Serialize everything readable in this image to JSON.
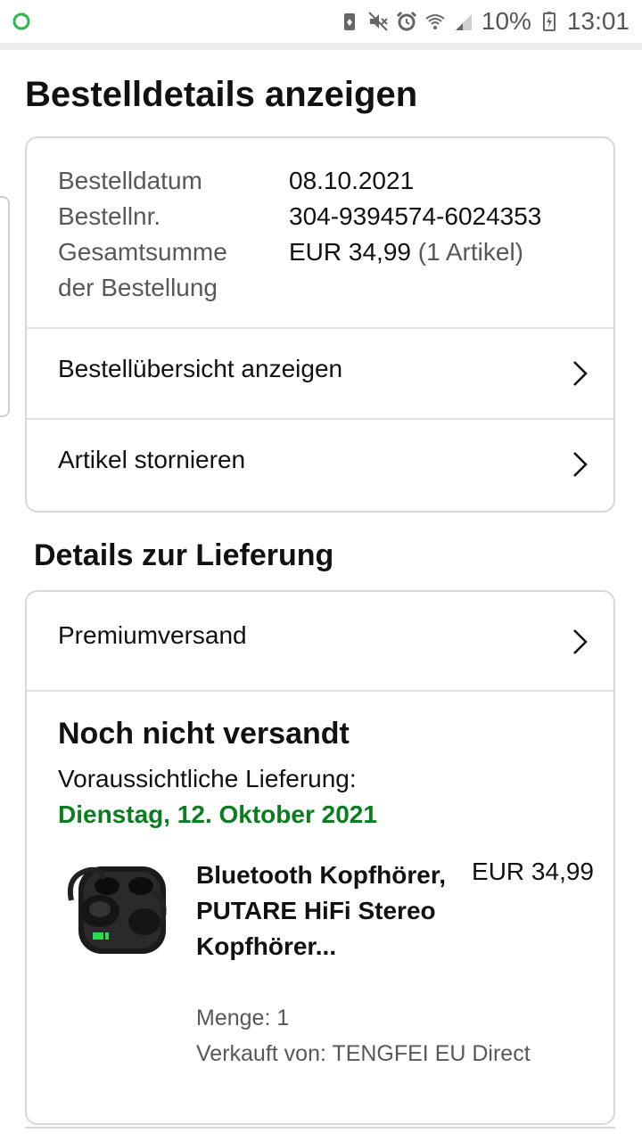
{
  "status_bar": {
    "battery_percent": "10%",
    "time": "13:01",
    "icons": [
      "sync-icon",
      "battery-saver-icon",
      "mute-icon",
      "alarm-icon",
      "wifi-icon",
      "signal-icon",
      "battery-icon"
    ]
  },
  "page_title": "Bestelldetails anzeigen",
  "order_summary": {
    "rows": [
      {
        "label": "Bestelldatum",
        "value": "08.10.2021"
      },
      {
        "label": "Bestellnr.",
        "value": "304-9394574-6024353"
      }
    ],
    "total_label_line1": "Gesamtsumme",
    "total_label_line2": "der Bestellung",
    "total_value": "EUR 34,99",
    "total_count": "(1 Artikel)"
  },
  "links": {
    "overview": "Bestellübersicht anzeigen",
    "cancel": "Artikel stornieren"
  },
  "delivery": {
    "section_title": "Details zur Lieferung",
    "shipping_method": "Premiumversand",
    "status": "Noch nicht versandt",
    "expected_label": "Voraussichtliche Lieferung:",
    "expected_date": "Dienstag, 12. Oktober 2021",
    "date_color": "#0a7e1f"
  },
  "product": {
    "title": "Bluetooth Kopfhörer, PUTARE HiFi Stereo Kopfhörer...",
    "price": "EUR 34,99",
    "quantity": "Menge: 1",
    "seller": "Verkauft von: TENGFEI EU Direct"
  }
}
